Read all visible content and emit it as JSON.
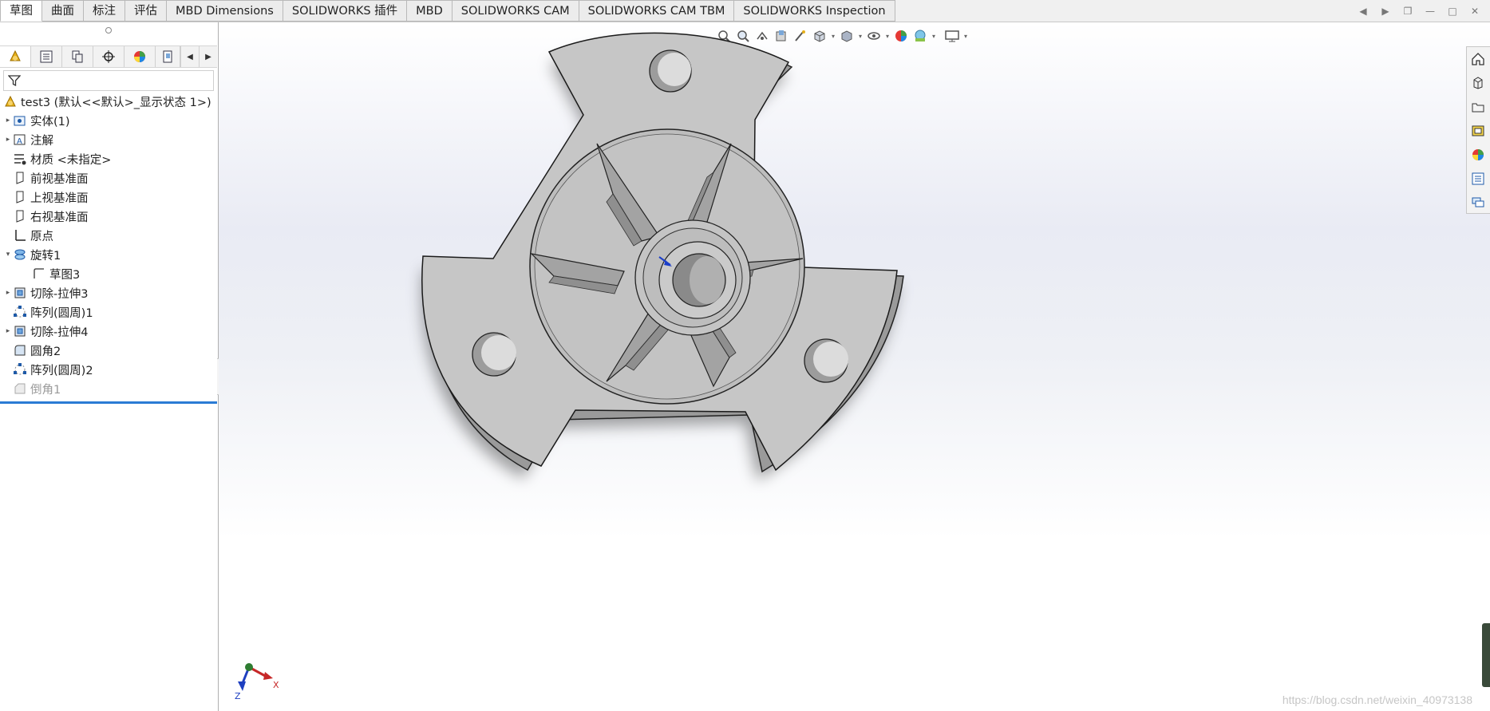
{
  "command_tabs": [
    "草图",
    "曲面",
    "标注",
    "评估",
    "MBD Dimensions",
    "SOLIDWORKS 插件",
    "MBD",
    "SOLIDWORKS CAM",
    "SOLIDWORKS CAM TBM",
    "SOLIDWORKS Inspection"
  ],
  "active_tab": "草图",
  "feature_tree": {
    "root_label": "test3  (默认<<默认>_显示状态 1>)",
    "items": [
      {
        "label": "实体(1)",
        "expandable": true,
        "icon": "solid-bodies-icon"
      },
      {
        "label": "注解",
        "expandable": true,
        "icon": "annotations-icon"
      },
      {
        "label": "材质 <未指定>",
        "expandable": false,
        "icon": "material-icon"
      },
      {
        "label": "前视基准面",
        "expandable": false,
        "icon": "plane-icon"
      },
      {
        "label": "上视基准面",
        "expandable": false,
        "icon": "plane-icon"
      },
      {
        "label": "右视基准面",
        "expandable": false,
        "icon": "plane-icon"
      },
      {
        "label": "原点",
        "expandable": false,
        "icon": "origin-icon"
      },
      {
        "label": "旋转1",
        "expandable": true,
        "expanded": true,
        "icon": "revolve-icon"
      },
      {
        "label": "草图3",
        "expandable": false,
        "icon": "sketch-icon",
        "child": true
      },
      {
        "label": "切除-拉伸3",
        "expandable": true,
        "icon": "cut-extrude-icon"
      },
      {
        "label": "阵列(圆周)1",
        "expandable": false,
        "icon": "circular-pattern-icon"
      },
      {
        "label": "切除-拉伸4",
        "expandable": true,
        "icon": "cut-extrude-icon"
      },
      {
        "label": "圆角2",
        "expandable": false,
        "icon": "fillet-icon"
      },
      {
        "label": "阵列(圆周)2",
        "expandable": false,
        "icon": "circular-pattern-icon"
      },
      {
        "label": "倒角1",
        "expandable": false,
        "icon": "chamfer-icon",
        "suppressed": true
      }
    ]
  },
  "triad": {
    "x_label": "X",
    "z_label": "Z"
  },
  "watermark": "https://blog.csdn.net/weixin_40973138",
  "colors": {
    "accent": "#2a7bd4",
    "part_face": "#c6c6c6",
    "part_shadow": "#9a9a9a"
  }
}
